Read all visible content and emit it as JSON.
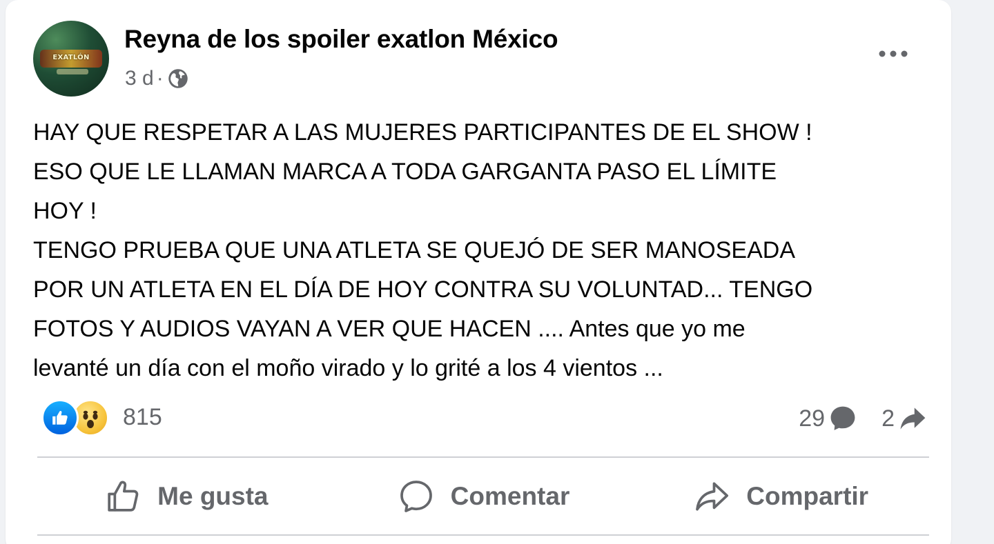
{
  "post": {
    "author": "Reyna de los spoiler exatlon México",
    "time": "3 d",
    "separator": "·",
    "avatar_text": "EXATLÓN",
    "body": "HAY QUE RESPETAR A LAS MUJERES PARTICIPANTES DE EL SHOW !\nESO QUE LE LLAMAN MARCA A TODA GARGANTA PASO EL LÍMITE\nHOY !\nTENGO PRUEBA QUE UNA ATLETA SE QUEJÓ DE SER MANOSEADA\nPOR UN ATLETA EN EL DÍA DE HOY CONTRA SU VOLUNTAD... TENGO\nFOTOS Y AUDIOS VAYAN A VER QUE HACEN .... Antes que  yo me\nlevanté un día con el moño virado y lo grité a los 4 vientos ..."
  },
  "stats": {
    "reactions_count": "815",
    "comments_count": "29",
    "shares_count": "2"
  },
  "actions": {
    "like": "Me gusta",
    "comment": "Comentar",
    "share": "Compartir"
  },
  "icons": {
    "more": "more-options-icon",
    "privacy": "globe-icon",
    "like_reaction": "like-reaction-icon",
    "wow_reaction": "wow-reaction-icon",
    "comment": "comment-bubble-icon",
    "share": "share-arrow-icon"
  },
  "colors": {
    "text_primary": "#050505",
    "text_secondary": "#65676b",
    "background": "#f0f2f5",
    "card": "#ffffff",
    "like_blue": "#0866ff",
    "divider": "#ced0d4"
  }
}
